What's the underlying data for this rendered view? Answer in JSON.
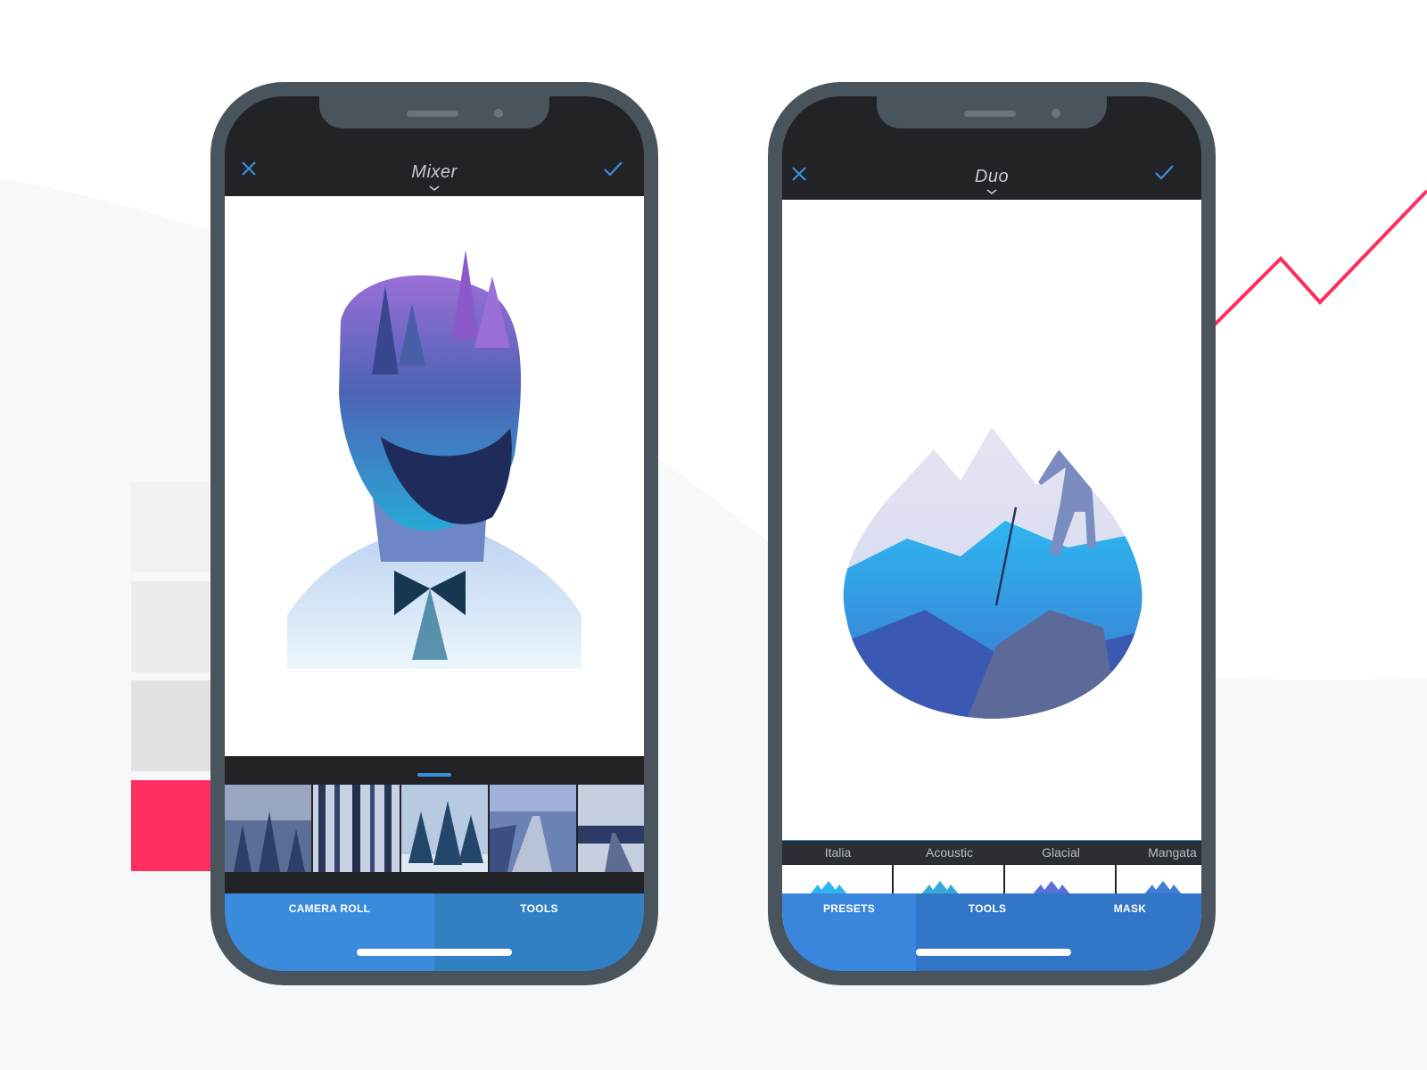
{
  "colors": {
    "accent_pink": "#ff2d60",
    "phone_frame": "#4a545c",
    "screen_dark": "#212327",
    "tab_blue": "#3a8bdc",
    "tab_blue_dark": "#3280c8",
    "icon_blue": "#3c8fdc"
  },
  "left_phone": {
    "title": "Mixer",
    "close_icon": "close-icon",
    "confirm_icon": "checkmark-icon",
    "thumbnails": [
      "foggy-forest",
      "tree-trunks",
      "pine-trees",
      "boardwalk",
      "road"
    ],
    "tabs": [
      {
        "label": "CAMERA ROLL",
        "selected": true
      },
      {
        "label": "TOOLS",
        "selected": false
      }
    ]
  },
  "right_phone": {
    "title": "Duo",
    "close_icon": "close-icon",
    "confirm_icon": "checkmark-icon",
    "presets": [
      {
        "label": "Italia"
      },
      {
        "label": "Acoustic"
      },
      {
        "label": "Glacial"
      },
      {
        "label": "Mangata"
      }
    ],
    "tabs": [
      {
        "label": "PRESETS",
        "selected": true
      },
      {
        "label": "TOOLS",
        "selected": false
      },
      {
        "label": "MASK",
        "selected": false
      }
    ]
  }
}
